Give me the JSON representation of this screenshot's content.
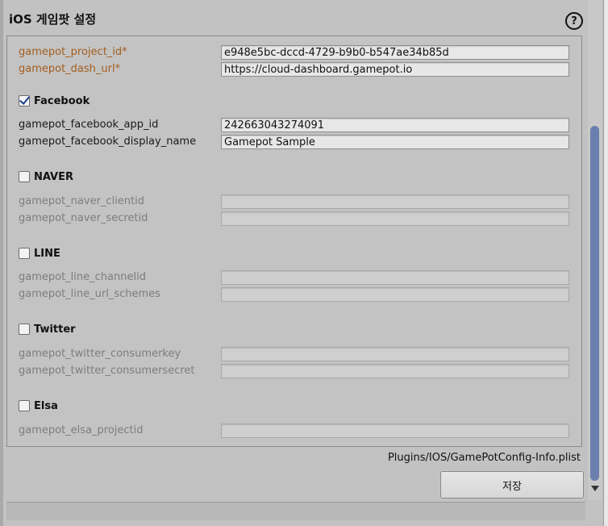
{
  "window": {
    "title": "iOS 게임팟 설정",
    "help_icon": "?"
  },
  "fields_required": [
    {
      "label": "gamepot_project_id*",
      "value": "e948e5bc-dccd-4729-b9b0-b547ae34b85d"
    },
    {
      "label": "gamepot_dash_url*",
      "value": "https://cloud-dashboard.gamepot.io"
    }
  ],
  "facebook": {
    "title": "Facebook",
    "checked": true,
    "fields": [
      {
        "label": "gamepot_facebook_app_id",
        "value": "242663043274091"
      },
      {
        "label": "gamepot_facebook_display_name",
        "value": "Gamepot Sample"
      }
    ]
  },
  "naver": {
    "title": "NAVER",
    "checked": false,
    "fields": [
      {
        "label": "gamepot_naver_clientid",
        "value": ""
      },
      {
        "label": "gamepot_naver_secretid",
        "value": ""
      }
    ]
  },
  "line": {
    "title": "LINE",
    "checked": false,
    "fields": [
      {
        "label": "gamepot_line_channelid",
        "value": ""
      },
      {
        "label": "gamepot_line_url_schemes",
        "value": ""
      }
    ]
  },
  "twitter": {
    "title": "Twitter",
    "checked": false,
    "fields": [
      {
        "label": "gamepot_twitter_consumerkey",
        "value": ""
      },
      {
        "label": "gamepot_twitter_consumersecret",
        "value": ""
      }
    ]
  },
  "elsa": {
    "title": "Elsa",
    "checked": false,
    "fields": [
      {
        "label": "gamepot_elsa_projectid",
        "value": ""
      }
    ]
  },
  "footer": {
    "path": "Plugins/IOS/GamePotConfig-Info.plist",
    "save_label": "저장"
  },
  "colors": {
    "required_label": "#a35e1e",
    "disabled_label": "#7d7d7d",
    "scroll_thumb": "#6b7fae"
  }
}
